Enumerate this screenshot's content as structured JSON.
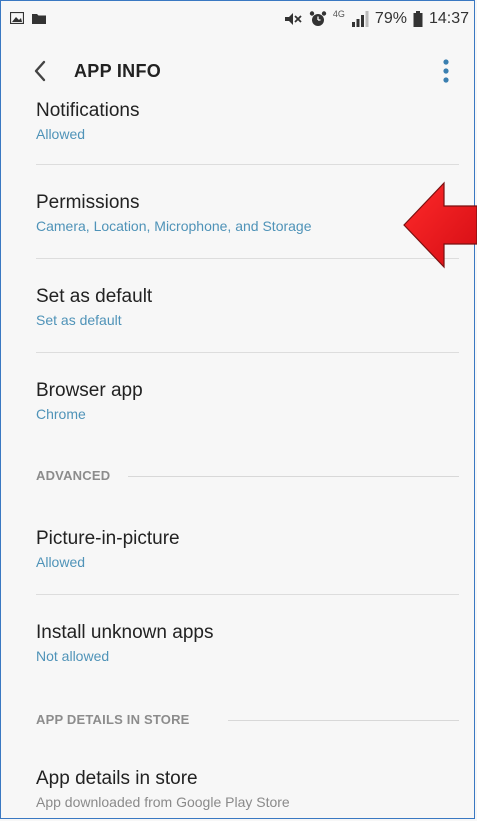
{
  "status_bar": {
    "battery_percent": "79%",
    "time": "14:37",
    "network": "4G"
  },
  "header": {
    "title": "APP INFO"
  },
  "items": {
    "notifications": {
      "label": "Notifications",
      "sub": "Allowed"
    },
    "permissions": {
      "label": "Permissions",
      "sub": "Camera, Location, Microphone, and Storage"
    },
    "set_default": {
      "label": "Set as default",
      "sub": "Set as default"
    },
    "browser": {
      "label": "Browser app",
      "sub": "Chrome"
    },
    "pip": {
      "label": "Picture-in-picture",
      "sub": "Allowed"
    },
    "unknown_apps": {
      "label": "Install unknown apps",
      "sub": "Not allowed"
    },
    "store": {
      "label": "App details in store",
      "sub": "App downloaded from Google Play Store"
    }
  },
  "sections": {
    "advanced": "ADVANCED",
    "store": "APP DETAILS IN STORE"
  },
  "colors": {
    "accent": "#4f93b8",
    "arrow": "#e8141b",
    "frame": "#3a78c2"
  },
  "icons": {
    "back": "chevron-left-icon",
    "more": "more-vertical-icon",
    "arrow": "red-arrow-annotation"
  }
}
